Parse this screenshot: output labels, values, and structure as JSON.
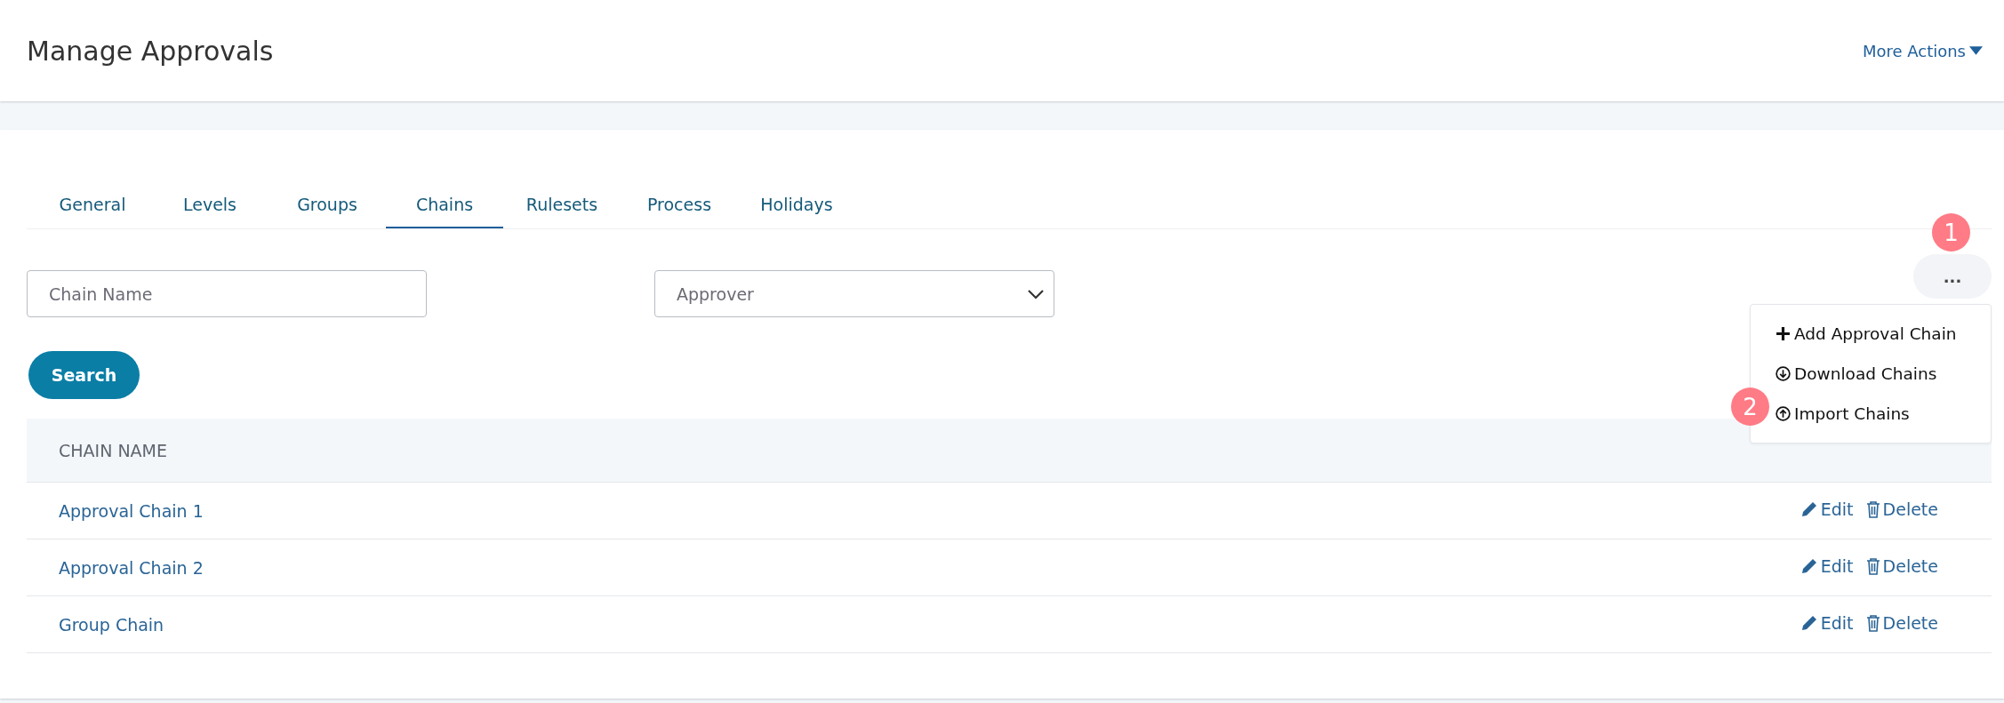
{
  "header": {
    "title": "Manage Approvals",
    "more_actions": "More Actions"
  },
  "tabs": [
    {
      "label": "General",
      "selected": false
    },
    {
      "label": "Levels",
      "selected": false
    },
    {
      "label": "Groups",
      "selected": false
    },
    {
      "label": "Chains",
      "selected": true
    },
    {
      "label": "Rulesets",
      "selected": false
    },
    {
      "label": "Process",
      "selected": false
    },
    {
      "label": "Holidays",
      "selected": false
    }
  ],
  "filters": {
    "chain_name": {
      "placeholder": "Chain Name"
    },
    "approver": {
      "placeholder": "Approver"
    }
  },
  "search_button": "Search",
  "overflow_button": "...",
  "menu": [
    {
      "kind": "add",
      "label": "Add Approval Chain"
    },
    {
      "kind": "download",
      "label": "Download Chains"
    },
    {
      "kind": "import",
      "label": "Import Chains"
    }
  ],
  "annotations": [
    {
      "label": "1"
    },
    {
      "label": "2"
    }
  ],
  "table": {
    "columns": [
      "CHAIN NAME"
    ],
    "rows": [
      {
        "name": "Approval Chain 1",
        "edit": "Edit",
        "delete": "Delete"
      },
      {
        "name": "Approval Chain 2",
        "edit": "Edit",
        "delete": "Delete"
      },
      {
        "name": "Group Chain",
        "edit": "Edit",
        "delete": "Delete"
      }
    ]
  }
}
